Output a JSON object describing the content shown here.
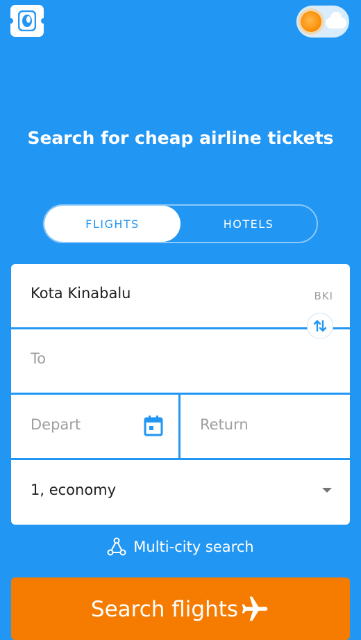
{
  "header": {
    "logo_icon": "boarding-pass-logo-icon",
    "theme_toggle_icon": "sun-cloud-toggle-icon"
  },
  "headline": "Search for cheap airline tickets",
  "tabs": [
    {
      "label": "FLIGHTS",
      "active": true
    },
    {
      "label": "HOTELS",
      "active": false
    }
  ],
  "form": {
    "from": {
      "value": "Kota Kinabalu",
      "code": "BKI"
    },
    "swap_icon": "swap-vertical-icon",
    "to": {
      "placeholder": "To"
    },
    "depart": {
      "placeholder": "Depart",
      "icon": "calendar-icon"
    },
    "return": {
      "placeholder": "Return"
    },
    "passengers": {
      "value": "1, economy",
      "icon": "chevron-down-icon"
    }
  },
  "multicity": {
    "label": "Multi-city search",
    "icon": "route-nodes-icon"
  },
  "search_button": {
    "label": "Search flights",
    "icon": "airplane-icon"
  },
  "colors": {
    "primary": "#2196f3",
    "accent": "#f57c00",
    "white": "#ffffff"
  }
}
